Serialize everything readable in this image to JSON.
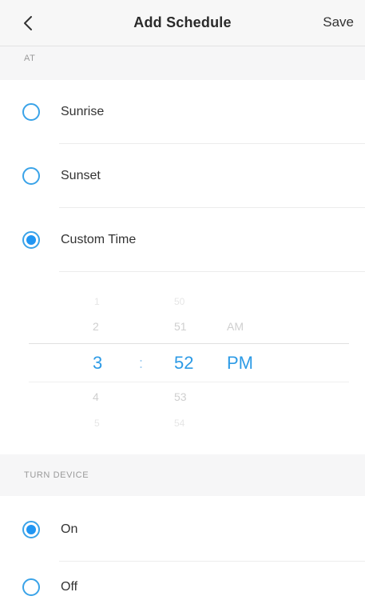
{
  "header": {
    "title": "Add Schedule",
    "save_label": "Save",
    "back_icon": "chevron-left-icon"
  },
  "sections": {
    "at_label": "AT",
    "turn_device_label": "TURN DEVICE"
  },
  "at_options": [
    {
      "label": "Sunrise",
      "selected": false
    },
    {
      "label": "Sunset",
      "selected": false
    },
    {
      "label": "Custom Time",
      "selected": true
    }
  ],
  "time_picker": {
    "hours": {
      "above2": "1",
      "above1": "2",
      "selected": "3",
      "below1": "4",
      "below2": "5"
    },
    "separator": ":",
    "minutes": {
      "above2": "50",
      "above1": "51",
      "selected": "52",
      "below1": "53",
      "below2": "54"
    },
    "period": {
      "above1": "AM",
      "selected": "PM"
    }
  },
  "turn_options": [
    {
      "label": "On",
      "selected": true
    },
    {
      "label": "Off",
      "selected": false
    }
  ],
  "colors": {
    "accent": "#2196f3",
    "selected_text": "#2d9be6"
  }
}
